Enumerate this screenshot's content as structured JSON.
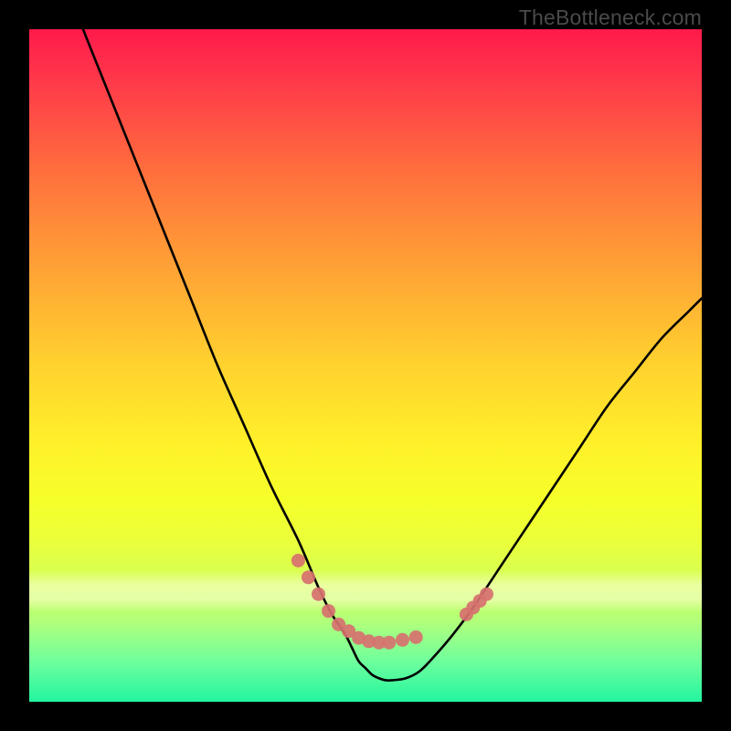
{
  "watermark": "TheBottleneck.com",
  "chart_data": {
    "type": "line",
    "title": "",
    "xlabel": "",
    "ylabel": "",
    "xlim": [
      0,
      100
    ],
    "ylim": [
      0,
      100
    ],
    "grid": false,
    "legend": false,
    "series": [
      {
        "name": "bottleneck-curve",
        "color": "#000000",
        "x": [
          8,
          12,
          16,
          20,
          24,
          28,
          32,
          36,
          40,
          43,
          45,
          47,
          48,
          49,
          50,
          51,
          52,
          53,
          54,
          56,
          58,
          60,
          63,
          66,
          70,
          74,
          78,
          82,
          86,
          90,
          94,
          98,
          100
        ],
        "values": [
          100,
          90,
          80,
          70,
          60,
          50,
          41,
          32,
          24,
          17,
          13,
          10,
          8,
          6,
          5,
          4,
          3.5,
          3.2,
          3.2,
          3.5,
          4.5,
          6.5,
          10,
          14,
          20,
          26,
          32,
          38,
          44,
          49,
          54,
          58,
          60
        ]
      }
    ],
    "overlay_points": {
      "name": "bead-markers",
      "color": "#d7716f",
      "x": [
        40,
        41.5,
        43,
        44.5,
        46,
        47.5,
        49,
        50.5,
        52,
        53.5,
        55.5,
        57.5,
        65,
        66,
        67,
        68
      ],
      "y": [
        21,
        18.5,
        16,
        13.5,
        11.5,
        10.5,
        9.5,
        9,
        8.8,
        8.8,
        9.2,
        9.6,
        13,
        14,
        15,
        16
      ]
    }
  }
}
